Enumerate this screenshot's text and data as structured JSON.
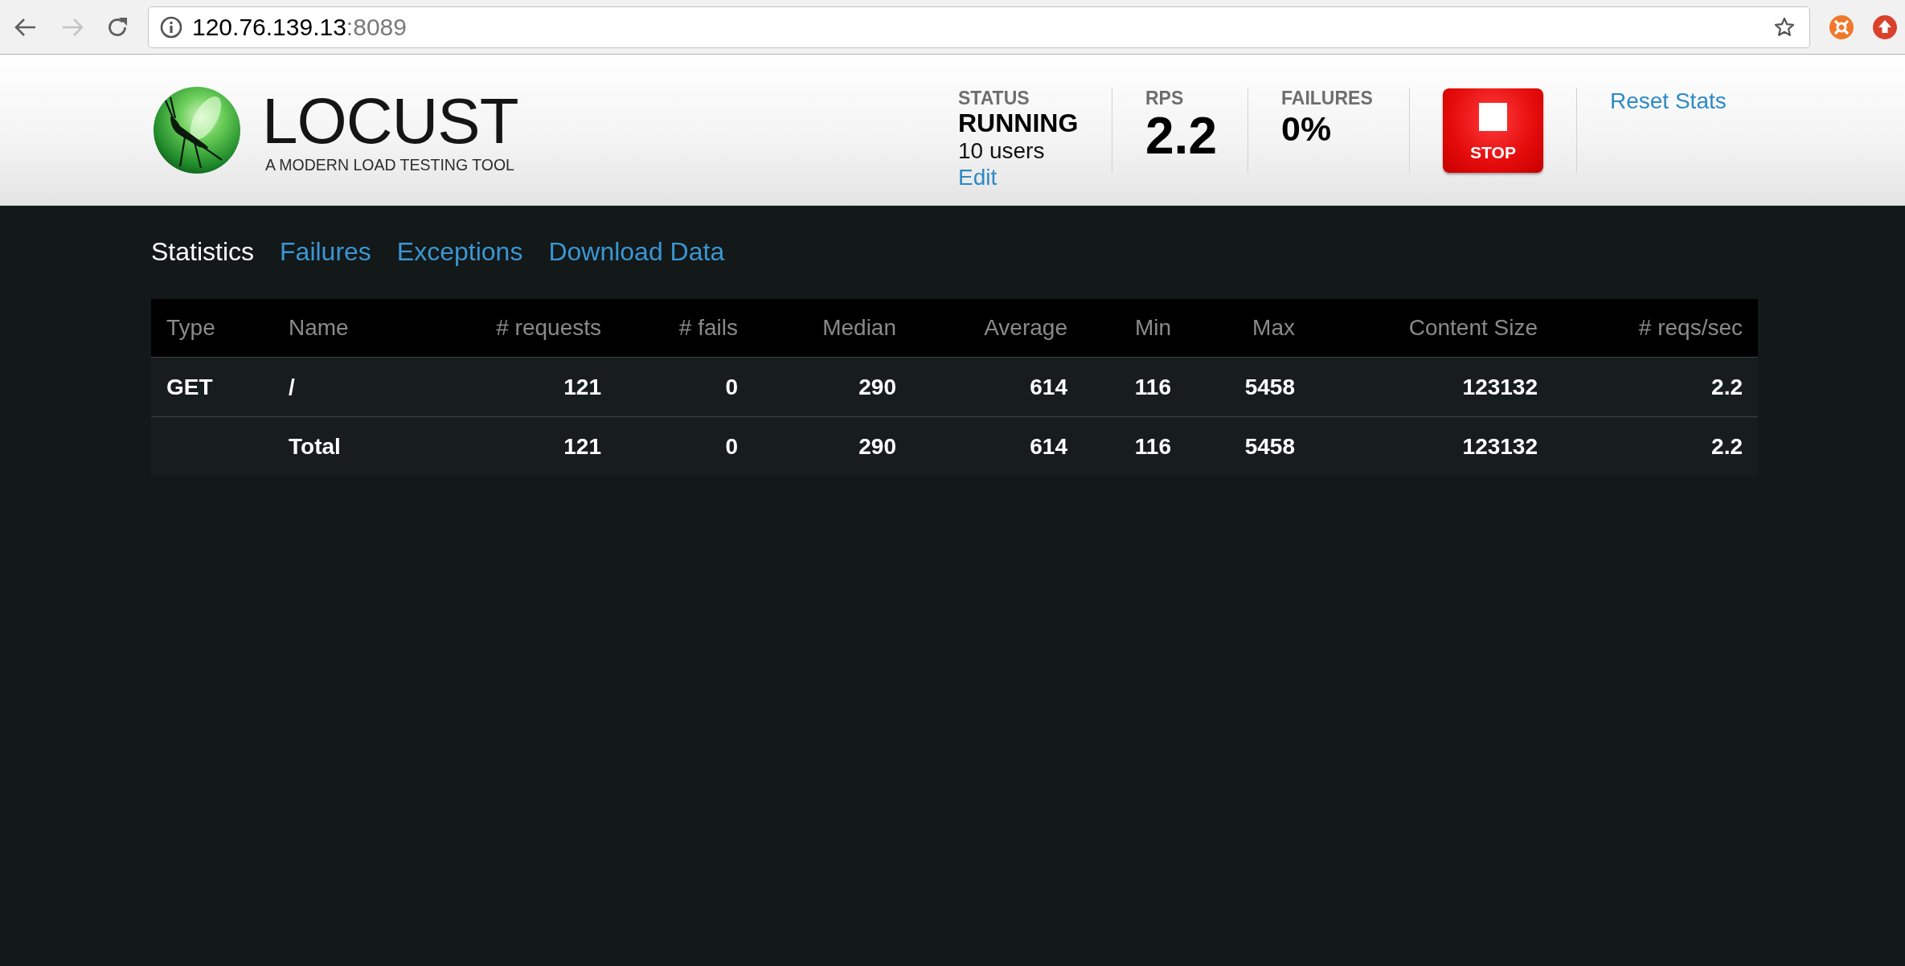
{
  "browser": {
    "back_disabled": false,
    "forward_disabled": true,
    "url": {
      "host": "120.76.139.13",
      "port": ":8089"
    }
  },
  "header": {
    "logo": {
      "name": "LOCUST",
      "tagline": "A MODERN LOAD TESTING TOOL"
    },
    "status": {
      "label": "STATUS",
      "value": "RUNNING",
      "users": "10 users",
      "edit_link": "Edit"
    },
    "rps": {
      "label": "RPS",
      "value": "2.2"
    },
    "failures": {
      "label": "FAILURES",
      "value": "0%"
    },
    "stop_button": "STOP",
    "reset_link": "Reset Stats"
  },
  "tabs": [
    {
      "label": "Statistics",
      "selected": true
    },
    {
      "label": "Failures",
      "selected": false
    },
    {
      "label": "Exceptions",
      "selected": false
    },
    {
      "label": "Download Data",
      "selected": false
    }
  ],
  "table": {
    "columns": [
      "Type",
      "Name",
      "# requests",
      "# fails",
      "Median",
      "Average",
      "Min",
      "Max",
      "Content Size",
      "# reqs/sec"
    ],
    "rows": [
      {
        "type": "GET",
        "name": "/",
        "requests": "121",
        "fails": "0",
        "median": "290",
        "average": "614",
        "min": "116",
        "max": "5458",
        "content_size": "123132",
        "reqs_per_sec": "2.2"
      },
      {
        "name": "Total",
        "requests": "121",
        "fails": "0",
        "median": "290",
        "average": "614",
        "min": "116",
        "max": "5458",
        "content_size": "123132",
        "reqs_per_sec": "2.2"
      }
    ]
  }
}
